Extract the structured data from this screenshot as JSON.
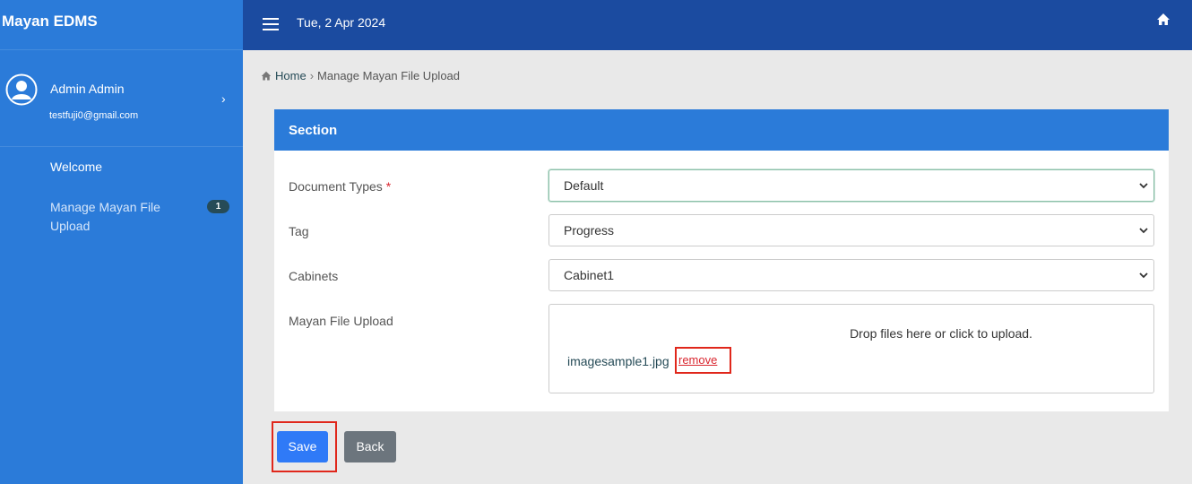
{
  "sidebar": {
    "brand": "Mayan EDMS",
    "user": {
      "name": "Admin Admin",
      "email": "testfuji0@gmail.com"
    },
    "items": [
      {
        "label": "Welcome"
      },
      {
        "label": "Manage Mayan File Upload",
        "badge": "1"
      }
    ]
  },
  "topbar": {
    "date": "Tue, 2 Apr 2024"
  },
  "breadcrumb": {
    "home": "Home",
    "separator": "›",
    "current": "Manage Mayan File Upload"
  },
  "section": {
    "title": "Section",
    "fields": {
      "document_types": {
        "label": "Document Types",
        "required_mark": "*",
        "value": "Default"
      },
      "tag": {
        "label": "Tag",
        "value": "Progress"
      },
      "cabinets": {
        "label": "Cabinets",
        "value": "Cabinet1"
      },
      "file_upload": {
        "label": "Mayan File Upload",
        "drop_text": "Drop files here or click to upload.",
        "file_name": "imagesample1.jpg",
        "remove_label": "remove"
      }
    }
  },
  "actions": {
    "save_label": "Save",
    "back_label": "Back"
  },
  "colors": {
    "sidebar": "#2b7bd9",
    "topbar": "#1b4ba0",
    "save": "#2f7af7",
    "back": "#6c757d",
    "highlight": "#e0271b"
  }
}
